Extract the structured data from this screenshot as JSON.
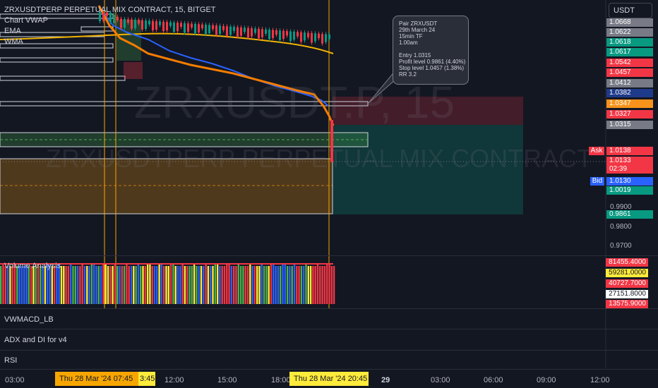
{
  "symbol_header": "ZRXUSDTPERP PERPETUAL MIX CONTRACT, 15, BITGET",
  "indicators": {
    "vwap": "Chart VWAP",
    "ema": "EMA",
    "wma": "WMA"
  },
  "watermark": {
    "line1": "ZRXUSDT.P, 15",
    "line2": "ZRXUSDTPERP PERPETUAL MIX CONTRACT"
  },
  "currency_button": "USDT",
  "callout": {
    "lines": [
      "Pair ZRXUSDT",
      "29th March 24",
      "15min TF",
      "1.00am",
      "",
      "Entry 1.0315",
      "Profit level 0.9861 (4.40%)",
      "Stop level 1.0457 (1.38%)",
      "RR 3.2"
    ]
  },
  "price_tags": [
    {
      "text": "1.0668",
      "color": "#787b86"
    },
    {
      "text": "1.0622",
      "color": "#787b86"
    },
    {
      "text": "1.0618",
      "color": "#089981"
    },
    {
      "text": "1.0617",
      "color": "#089981"
    },
    {
      "text": "1.0542",
      "color": "#f23645"
    },
    {
      "text": "1.0457",
      "color": "#f23645"
    },
    {
      "text": "1.0412",
      "color": "#787b86"
    },
    {
      "text": "1.0382",
      "color": "#1e3a8a"
    },
    {
      "text": "1.0347",
      "color": "#f7931a"
    },
    {
      "text": "1.0327",
      "color": "#f23645"
    },
    {
      "text": "1.0315",
      "color": "#787b86"
    }
  ],
  "ask": {
    "label": "Ask",
    "value": "1.0138"
  },
  "last": {
    "value": "1.0133",
    "countdown": "02:39"
  },
  "bid": {
    "label": "Bid",
    "value": "1.0130"
  },
  "tag_1019": "1.0019",
  "tag_9861": "0.9861",
  "axis_labels": [
    "0.9900",
    "0.9800",
    "0.9700"
  ],
  "volume": {
    "title": "Volume Analysis",
    "tags": [
      {
        "text": "81455.4000",
        "bg": "#f23645",
        "fg": "#ffffff"
      },
      {
        "text": "59281.0000",
        "bg": "#ffeb3b",
        "fg": "#131722"
      },
      {
        "text": "40727.7000",
        "bg": "#f23645",
        "fg": "#ffffff"
      },
      {
        "text": "27151.8000",
        "bg": "#ffffff",
        "fg": "#131722"
      },
      {
        "text": "13575.9000",
        "bg": "#f23645",
        "fg": "#ffffff"
      }
    ]
  },
  "panes": [
    "VWMACD_LB",
    "ADX and DI for v4",
    "RSI"
  ],
  "time_axis": {
    "labels": [
      "03:00",
      "12:00",
      "15:00",
      "18:00",
      "29",
      "03:00",
      "06:00",
      "09:00",
      "12:00"
    ],
    "badge_left": "Thu 28 Mar '24   07:45",
    "badge_left_tail": "3:45",
    "badge_right": "Thu 28 Mar '24   20:45"
  }
}
